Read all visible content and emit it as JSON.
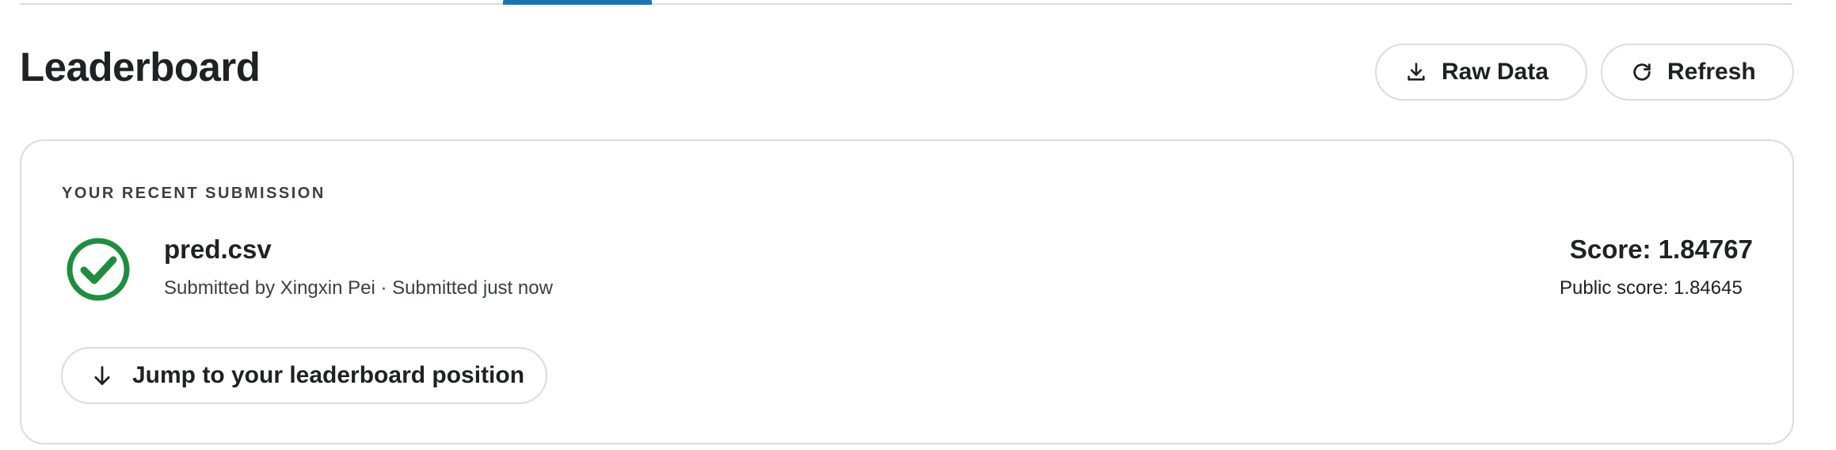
{
  "tabs": {
    "active_indicator_color": "#1a73b8"
  },
  "header": {
    "title": "Leaderboard",
    "raw_data_label": "Raw Data",
    "raw_data_icon": "download-icon",
    "refresh_label": "Refresh",
    "refresh_icon": "refresh-icon"
  },
  "submission": {
    "section_label": "YOUR RECENT SUBMISSION",
    "status_icon": "check-circle-icon",
    "status_color": "#1e8e3e",
    "file_name": "pred.csv",
    "submitted_line": "Submitted by Xingxin Pei · Submitted just now",
    "score": "Score: 1.84767",
    "public_score": "Public score: 1.84645",
    "jump_label": "Jump to your leaderboard position",
    "jump_icon": "arrow-down-icon"
  }
}
